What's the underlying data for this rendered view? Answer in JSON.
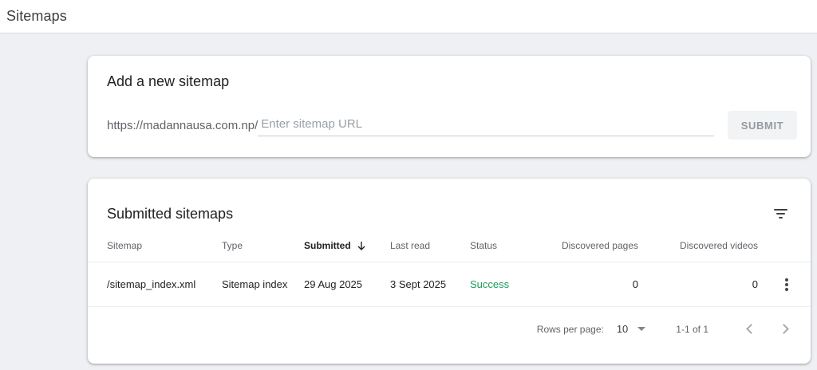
{
  "page": {
    "title": "Sitemaps"
  },
  "add_sitemap_card": {
    "title": "Add a new sitemap",
    "url_prefix": "https://madannausa.com.np/",
    "input_placeholder": "Enter sitemap URL",
    "input_value": "",
    "submit_label": "SUBMIT"
  },
  "submitted_card": {
    "title": "Submitted sitemaps",
    "columns": [
      "Sitemap",
      "Type",
      "Submitted",
      "Last read",
      "Status",
      "Discovered pages",
      "Discovered videos"
    ],
    "sort": {
      "column": "Submitted",
      "direction": "descending"
    },
    "rows": [
      {
        "sitemap": "/sitemap_index.xml",
        "type": "Sitemap index",
        "submitted": "29 Aug 2025",
        "last_read": "3 Sept 2025",
        "status": "Success",
        "discovered_pages": "0",
        "discovered_videos": "0"
      }
    ],
    "pagination": {
      "rows_per_page_label": "Rows per page:",
      "rows_per_page_value": "10",
      "range_label": "1-1 of 1"
    }
  },
  "colors": {
    "success": "#1a9e5c"
  }
}
